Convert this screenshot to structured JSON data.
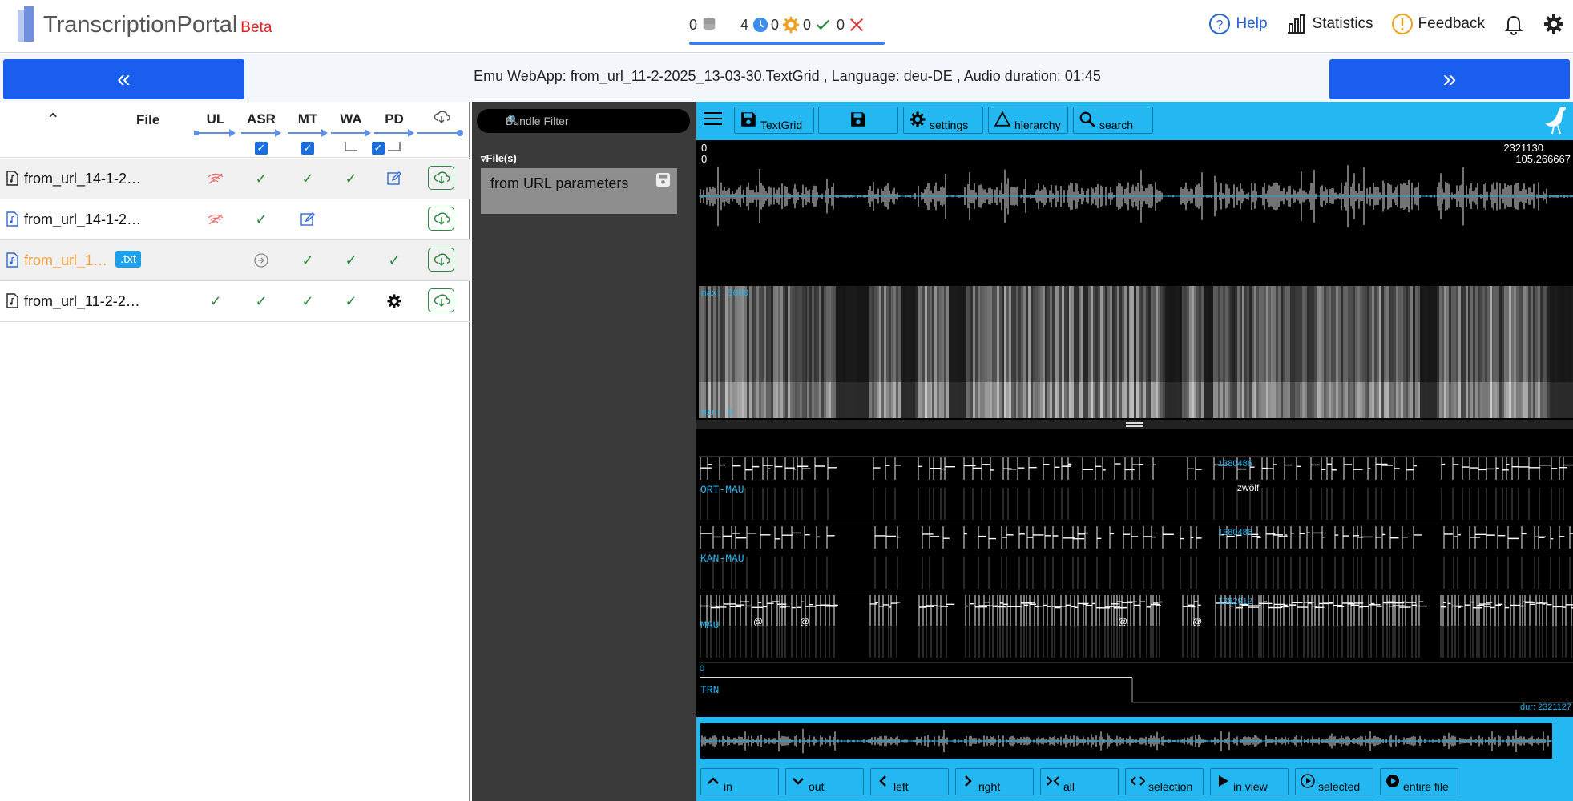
{
  "app": {
    "brand": "TranscriptionPortal",
    "beta": "Beta"
  },
  "status": {
    "database": "0",
    "clock": "4",
    "gear": "0",
    "check": "0",
    "error": "0"
  },
  "topnav": {
    "help": "Help",
    "statistics": "Statistics",
    "feedback": "Feedback"
  },
  "colors": {
    "accent": "#1a5ef0",
    "emu": "#23b8f2",
    "ok": "#2b8a3e",
    "warn": "#f2a23c"
  },
  "page": {
    "title": "Emu WebApp: from_url_11-2-2025_13-03-30.TextGrid , Language: deu-DE , Audio duration: 01:45"
  },
  "table": {
    "headers": {
      "sort": "^",
      "file": "File",
      "ul": "UL",
      "asr": "ASR",
      "mt": "MT",
      "wa": "WA",
      "pd": "PD"
    },
    "rows": [
      {
        "name": "from_url_14-1-2…"
      },
      {
        "name": "from_url_14-1-2…"
      },
      {
        "name": "from_url_1…",
        "badge": ".txt"
      },
      {
        "name": "from_url_11-2-2…"
      }
    ]
  },
  "bundles": {
    "filter_placeholder": "Bundle Filter",
    "files_label": "▿File(s)",
    "item": "from URL parameters"
  },
  "emu": {
    "toolbar": {
      "textgrid": "TextGrid",
      "settings": "settings",
      "hierarchy": "hierarchy",
      "search": "search"
    },
    "wave": {
      "start_sample": "0",
      "start_time": "0",
      "end_sample": "2321130",
      "end_time": "105.266667"
    },
    "spectro": {
      "max": "max: 5000",
      "min": "min: 0"
    },
    "tiers": [
      {
        "name": "ORT-MAU",
        "boundary": "1380486",
        "word": "zwölf"
      },
      {
        "name": "KAN-MAU",
        "boundary": "1380486"
      },
      {
        "name": "MAU",
        "boundary": "1382912",
        "symbol": "@"
      },
      {
        "name": "TRN",
        "start": "0",
        "dur": "dur: 2321127"
      }
    ],
    "bottom": {
      "in": "in",
      "out": "out",
      "left": "left",
      "right": "right",
      "all": "all",
      "selection": "selection",
      "in_view": "in view",
      "selected": "selected",
      "entire_file": "entire file"
    }
  }
}
